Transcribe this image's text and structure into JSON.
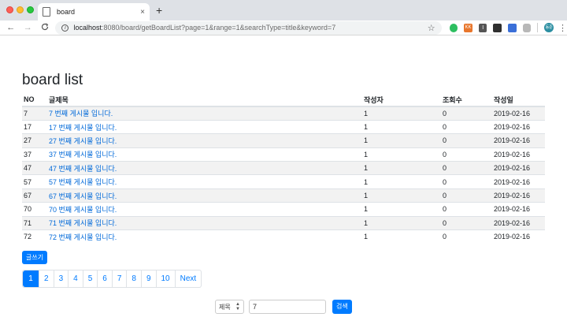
{
  "browser": {
    "tab_title": "board",
    "tab_close": "×",
    "new_tab": "+",
    "url_host": "localhost",
    "url_path": ":8080/board/getBoardList?page=1&range=1&searchType=title&keyword=7",
    "back": "←",
    "forward": "→",
    "reload": "C",
    "star": "☆",
    "menu": "⋮",
    "profile": "동준",
    "ext_kk": "KK",
    "ext_i": "I"
  },
  "page": {
    "title": "board list",
    "columns": [
      "NO",
      "글제목",
      "작성자",
      "조회수",
      "작성일"
    ],
    "rows": [
      {
        "no": "7",
        "title": "7 번째 게시물 입니다.",
        "writer": "1",
        "views": "0",
        "date": "2019-02-16"
      },
      {
        "no": "17",
        "title": "17 번째 게시물 입니다.",
        "writer": "1",
        "views": "0",
        "date": "2019-02-16"
      },
      {
        "no": "27",
        "title": "27 번째 게시물 입니다.",
        "writer": "1",
        "views": "0",
        "date": "2019-02-16"
      },
      {
        "no": "37",
        "title": "37 번째 게시물 입니다.",
        "writer": "1",
        "views": "0",
        "date": "2019-02-16"
      },
      {
        "no": "47",
        "title": "47 번째 게시물 입니다.",
        "writer": "1",
        "views": "0",
        "date": "2019-02-16"
      },
      {
        "no": "57",
        "title": "57 번째 게시물 입니다.",
        "writer": "1",
        "views": "0",
        "date": "2019-02-16"
      },
      {
        "no": "67",
        "title": "67 번째 게시물 입니다.",
        "writer": "1",
        "views": "0",
        "date": "2019-02-16"
      },
      {
        "no": "70",
        "title": "70 번째 게시물 입니다.",
        "writer": "1",
        "views": "0",
        "date": "2019-02-16"
      },
      {
        "no": "71",
        "title": "71 번째 게시물 입니다.",
        "writer": "1",
        "views": "0",
        "date": "2019-02-16"
      },
      {
        "no": "72",
        "title": "72 번째 게시물 입니다.",
        "writer": "1",
        "views": "0",
        "date": "2019-02-16"
      }
    ],
    "write_button": "글쓰기",
    "pages": [
      "1",
      "2",
      "3",
      "4",
      "5",
      "6",
      "7",
      "8",
      "9",
      "10",
      "Next"
    ],
    "search": {
      "type_selected": "제목",
      "keyword_value": "7",
      "button": "검색"
    }
  },
  "colors": {
    "primary": "#007bff",
    "link": "#0069d9",
    "stripe": "#f2f2f2"
  }
}
